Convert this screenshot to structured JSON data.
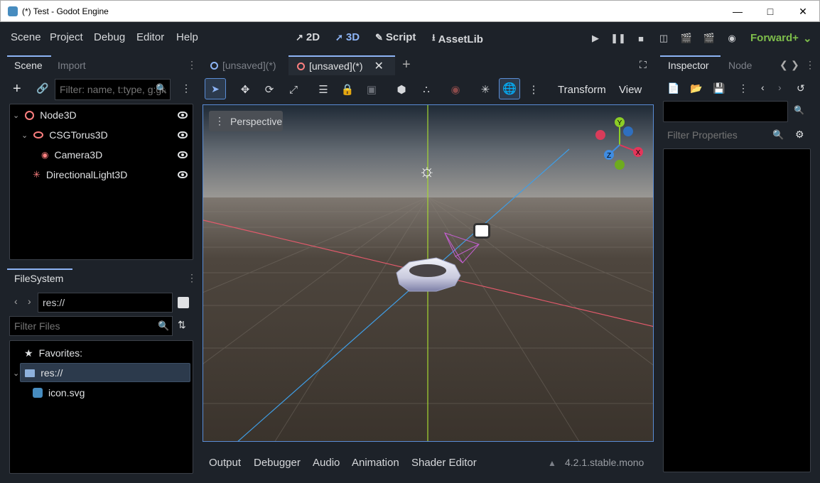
{
  "window": {
    "title": "(*) Test - Godot Engine"
  },
  "menubar": {
    "menus": [
      "Scene",
      "Project",
      "Debug",
      "Editor",
      "Help"
    ],
    "modes": {
      "m2d": "2D",
      "m3d": "3D",
      "script": "Script",
      "assetlib": "AssetLib"
    },
    "renderer": "Forward+"
  },
  "scene_dock": {
    "tabs": {
      "scene": "Scene",
      "import": "Import"
    },
    "filter_placeholder": "Filter: name, t:type, g:group",
    "nodes": [
      {
        "label": "Node3D"
      },
      {
        "label": "CSGTorus3D"
      },
      {
        "label": "Camera3D"
      },
      {
        "label": "DirectionalLight3D"
      }
    ]
  },
  "filesystem_dock": {
    "title": "FileSystem",
    "path": "res://",
    "filter_placeholder": "Filter Files",
    "favorites": "Favorites:",
    "root": "res://",
    "file": "icon.svg"
  },
  "editor_tabs": [
    {
      "label": "[unsaved](*)"
    },
    {
      "label": "[unsaved](*)"
    }
  ],
  "viewport_toolbar": {
    "transform": "Transform",
    "view": "View",
    "perspective": "Perspective"
  },
  "inspector": {
    "tabs": {
      "inspector": "Inspector",
      "node": "Node"
    },
    "filter_placeholder": "Filter Properties"
  },
  "bottom_panel": {
    "tabs": [
      "Output",
      "Debugger",
      "Audio",
      "Animation",
      "Shader Editor"
    ],
    "version": "4.2.1.stable.mono"
  },
  "colors": {
    "accent": "#8db4f5",
    "node3d": "#fc7f7f",
    "renderer": "#7ebe4b"
  }
}
